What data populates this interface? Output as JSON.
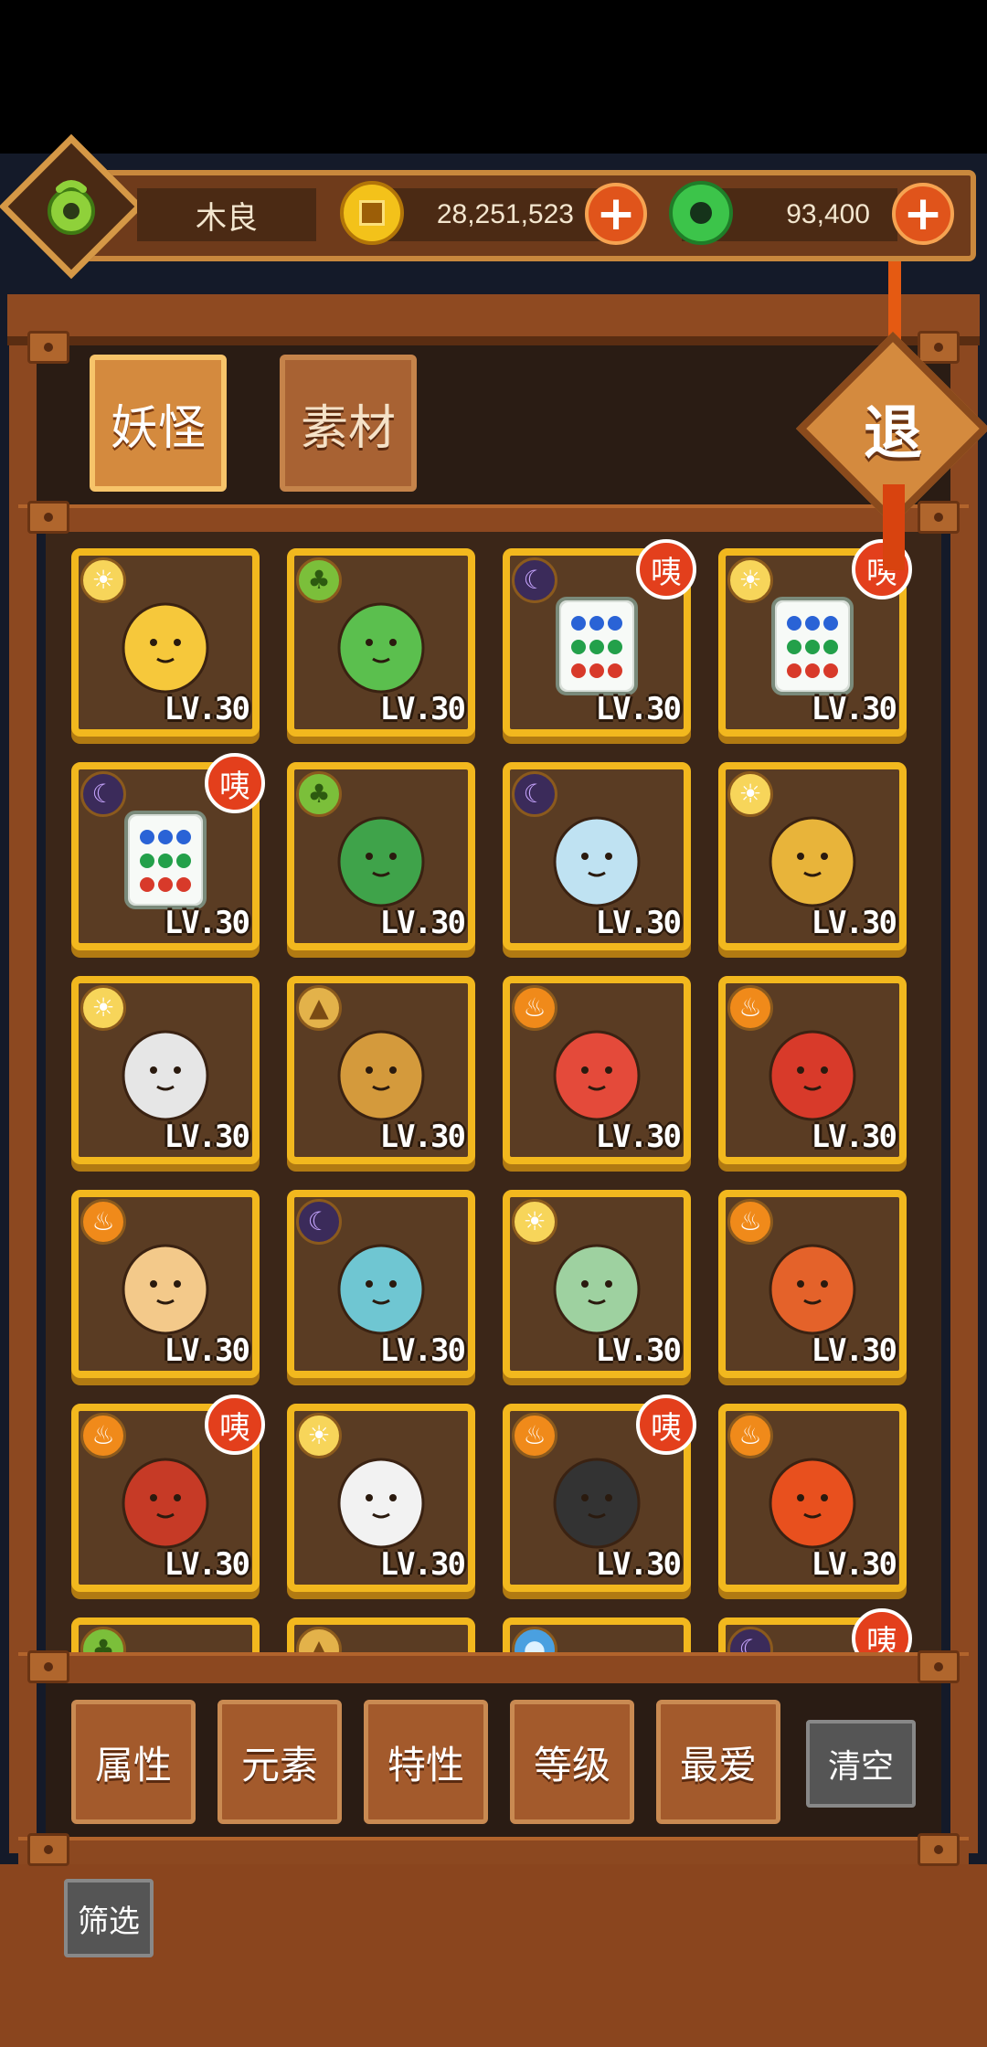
{
  "player": {
    "name": "木良",
    "avatar_icon": "jade-ring-icon"
  },
  "currency": {
    "coins": "28,251,523",
    "jade": "93,400",
    "coin_icon": "gold-coin-icon",
    "jade_icon": "jade-disc-icon",
    "add_label": "+"
  },
  "tabs": [
    {
      "label": "妖怪",
      "active": true
    },
    {
      "label": "素材",
      "active": false
    }
  ],
  "exit_label": "退",
  "monsters": [
    {
      "level": "LV.30",
      "element": "light",
      "art": "yellow-egg",
      "badge": ""
    },
    {
      "level": "LV.30",
      "element": "wood",
      "art": "green-gourd",
      "badge": ""
    },
    {
      "level": "LV.30",
      "element": "dark",
      "art": "mahjong-tile",
      "badge": "咦"
    },
    {
      "level": "LV.30",
      "element": "light",
      "art": "mahjong-tile",
      "badge": "咦"
    },
    {
      "level": "LV.30",
      "element": "dark",
      "art": "mahjong-tile",
      "badge": "咦"
    },
    {
      "level": "LV.30",
      "element": "wood",
      "art": "green-medusa",
      "badge": ""
    },
    {
      "level": "LV.30",
      "element": "dark",
      "art": "ice-demon",
      "badge": ""
    },
    {
      "level": "LV.30",
      "element": "light",
      "art": "yellow-girl",
      "badge": ""
    },
    {
      "level": "LV.30",
      "element": "light",
      "art": "silver-hair",
      "badge": ""
    },
    {
      "level": "LV.30",
      "element": "earth",
      "art": "golden-beast",
      "badge": ""
    },
    {
      "level": "LV.30",
      "element": "fire",
      "art": "red-phoenix",
      "badge": ""
    },
    {
      "level": "LV.30",
      "element": "fire",
      "art": "red-hat-girl",
      "badge": ""
    },
    {
      "level": "LV.30",
      "element": "fire",
      "art": "matchstick",
      "badge": ""
    },
    {
      "level": "LV.30",
      "element": "dark",
      "art": "blue-slime",
      "badge": ""
    },
    {
      "level": "LV.30",
      "element": "light",
      "art": "green-fox",
      "badge": ""
    },
    {
      "level": "LV.30",
      "element": "fire",
      "art": "fire-lion",
      "badge": ""
    },
    {
      "level": "LV.30",
      "element": "fire",
      "art": "red-warrior",
      "badge": "咦"
    },
    {
      "level": "LV.30",
      "element": "light",
      "art": "white-dragon",
      "badge": ""
    },
    {
      "level": "LV.30",
      "element": "fire",
      "art": "masked-cat",
      "badge": "咦"
    },
    {
      "level": "LV.30",
      "element": "fire",
      "art": "flame-beast",
      "badge": ""
    },
    {
      "level": "",
      "element": "wood",
      "art": "roof",
      "badge": ""
    },
    {
      "level": "",
      "element": "earth",
      "art": "white-creature",
      "badge": ""
    },
    {
      "level": "",
      "element": "water",
      "art": "",
      "badge": ""
    },
    {
      "level": "",
      "element": "dark",
      "art": "",
      "badge": "咦"
    }
  ],
  "filters": [
    "属性",
    "元素",
    "特性",
    "等级",
    "最爱"
  ],
  "clear_label": "清空",
  "screen_label": "筛选",
  "colors": {
    "card_border": "#f2b81e",
    "card_bg": "#5a3c23",
    "wood": "#8c4820",
    "badge": "#e33f1c"
  }
}
